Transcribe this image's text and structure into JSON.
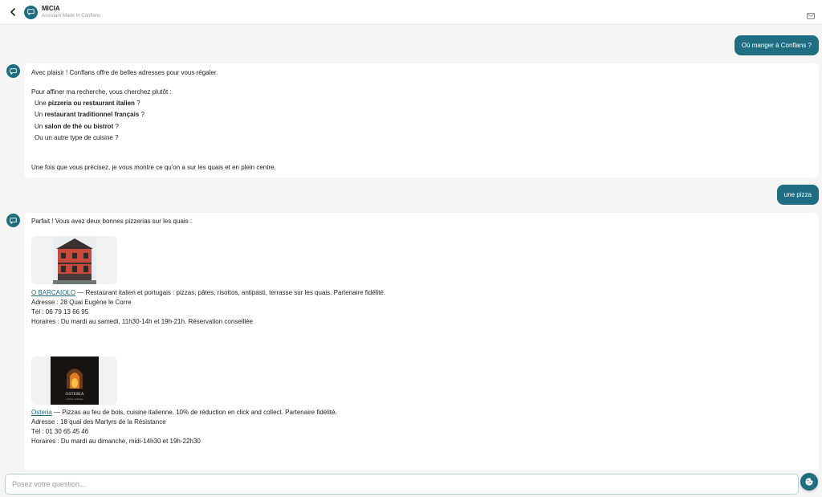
{
  "header": {
    "title": "MICIA",
    "subtitle": "Assistant Made In Conflans"
  },
  "conversation": {
    "user_message_1": "Où manger à Conflans ?",
    "bot_message_1": {
      "intro": "Avec plaisir ! Conflans offre de belles adresses pour vous régaler.",
      "question": "Pour affiner ma recherche, vous cherchez plutôt :",
      "options": [
        {
          "prefix": "Une ",
          "bold": "pizzeria ou restaurant italien",
          "suffix": " ?"
        },
        {
          "prefix": "Un ",
          "bold": "restaurant traditionnel français",
          "suffix": " ?"
        },
        {
          "prefix": "Un ",
          "bold": "salon de thé ou bistrot",
          "suffix": " ?"
        },
        {
          "prefix": "Ou un autre type de cuisine ?",
          "bold": "",
          "suffix": ""
        }
      ],
      "outro": "Une fois que vous précisez, je vous montre ce qu'on a sur les quais et en plein centre."
    },
    "user_message_2": "une pizza",
    "bot_message_2": {
      "intro": "Parfait ! Vous avez deux bonnes pizzerias sur les quais :",
      "restaurants": [
        {
          "name": "O BARCAIOLO",
          "description": " — Restaurant italien et portugais : pizzas, pâtes, risottos, antipasti, terrasse sur les quais. Partenaire fidélité.",
          "address": "Adresse : 28 Quai Eugène le Corre",
          "phone": "Tél : 06 79 13 66 95",
          "hours": "Horaires : Du mardi au samedi, 11h30-14h et 19h-21h. Réservation conseillée"
        },
        {
          "name": "Osteria",
          "description": " — Pizzas au feu de bois, cuisine italienne. 10% de réduction en click and collect. Partenaire fidélité.",
          "address": "Adresse : 18 quai des Martyrs de la Résistance",
          "phone": "Tél : 01 30 65 45 46",
          "hours": "Horaires : Du mardi au dimanche, midi-14h30 et 19h-22h30",
          "logo_text": "OSTERIA",
          "logo_subtext": "Cucina casalinga"
        }
      ]
    }
  },
  "input": {
    "placeholder": "Posez votre question..."
  },
  "colors": {
    "accent": "#1e6d80",
    "background": "#f5f5f4"
  },
  "icons": {
    "back": "chevron-left-icon",
    "avatar": "chat-bubble-icon",
    "mail": "mail-icon",
    "send": "cookie-icon"
  }
}
